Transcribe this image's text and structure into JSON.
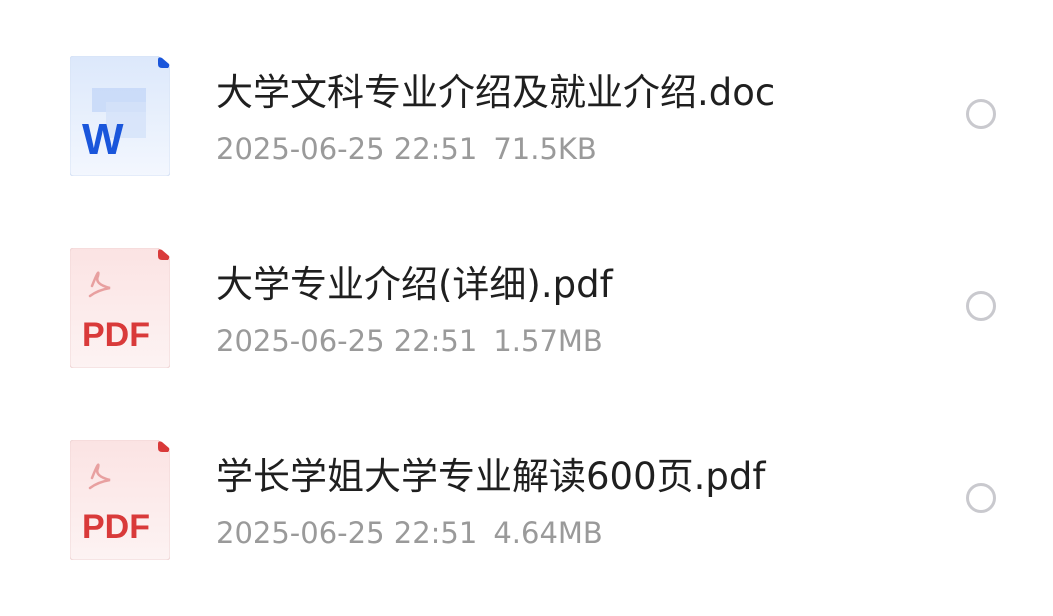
{
  "files": [
    {
      "name": "大学文科专业介绍及就业介绍.doc",
      "date": "2025-06-25 22:51",
      "size": "71.5KB",
      "icon": "word-doc-icon",
      "icon_label": "W",
      "accent": "#1a56db"
    },
    {
      "name": "大学专业介绍(详细).pdf",
      "date": "2025-06-25 22:51",
      "size": "1.57MB",
      "icon": "pdf-file-icon",
      "icon_label": "PDF",
      "accent": "#d93a3a"
    },
    {
      "name": "学长学姐大学专业解读600页.pdf",
      "date": "2025-06-25 22:51",
      "size": "4.64MB",
      "icon": "pdf-file-icon",
      "icon_label": "PDF",
      "accent": "#d93a3a"
    }
  ]
}
